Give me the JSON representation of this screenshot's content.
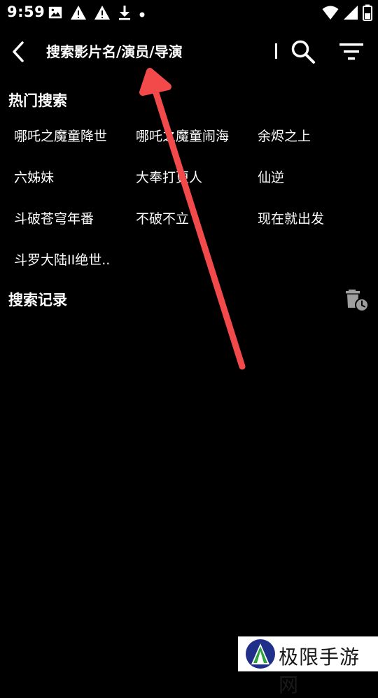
{
  "status_bar": {
    "time": "9:59",
    "left_icons": [
      "image-icon",
      "warning-icon",
      "warning-icon",
      "download-icon",
      "dot-icon"
    ],
    "right_icons": [
      "wifi-icon",
      "signal-icon",
      "battery-icon"
    ]
  },
  "toolbar": {
    "search_placeholder": "搜索影片名/演员/导演"
  },
  "hot_search": {
    "title": "热门搜索",
    "items": [
      "哪吒之魔童降世",
      "哪吒之魔童闹海",
      "余烬之上",
      "六姊妹",
      "大奉打更人",
      "仙逆",
      "斗破苍穹年番",
      "不破不立",
      "现在就出发",
      "斗罗大陆II绝世.."
    ]
  },
  "search_history": {
    "title": "搜索记录"
  },
  "watermark": {
    "text": "极限手游网"
  },
  "colors": {
    "background": "#000000",
    "text": "#ffffff",
    "arrow": "#f24a4a",
    "icon_gray": "#9e9e9e"
  }
}
